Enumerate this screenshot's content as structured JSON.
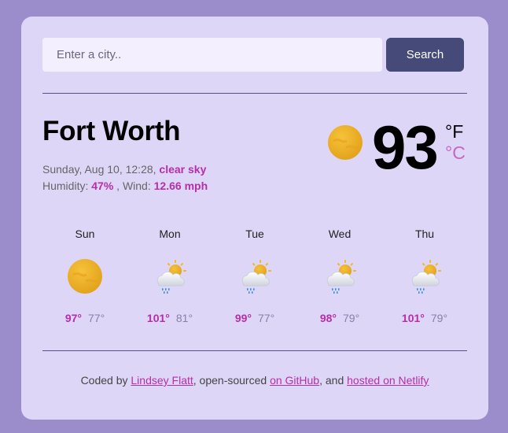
{
  "search": {
    "placeholder": "Enter a city..",
    "value": "",
    "button_label": "Search"
  },
  "current": {
    "city": "Fort Worth",
    "date": "Sunday, Aug 10, 12:28,",
    "description": "clear sky",
    "humidity_label": "Humidity:",
    "humidity": "47%",
    "wind_label": ", Wind:",
    "wind": "12.66 mph",
    "temperature": "93",
    "unit_f": "°F",
    "unit_c": "°C",
    "icon": "clear-sun-icon"
  },
  "forecast": [
    {
      "day": "Sun",
      "high": "97°",
      "low": "77°",
      "icon": "clear-sun-icon"
    },
    {
      "day": "Mon",
      "high": "101°",
      "low": "81°",
      "icon": "sun-cloud-rain-icon"
    },
    {
      "day": "Tue",
      "high": "99°",
      "low": "77°",
      "icon": "sun-cloud-rain-icon"
    },
    {
      "day": "Wed",
      "high": "98°",
      "low": "79°",
      "icon": "sun-cloud-rain-icon"
    },
    {
      "day": "Thu",
      "high": "101°",
      "low": "79°",
      "icon": "sun-cloud-rain-icon"
    }
  ],
  "footer": {
    "prefix": "Coded by ",
    "author_link": "Lindsey Flatt",
    "middle": ", open-sourced ",
    "github_link": "on GitHub",
    "and": ", and ",
    "netlify_link": "hosted on Netlify"
  },
  "colors": {
    "accent": "#b42fa8",
    "background": "#9b8ccc",
    "card": "#ddd6f7",
    "button": "#454a78"
  }
}
